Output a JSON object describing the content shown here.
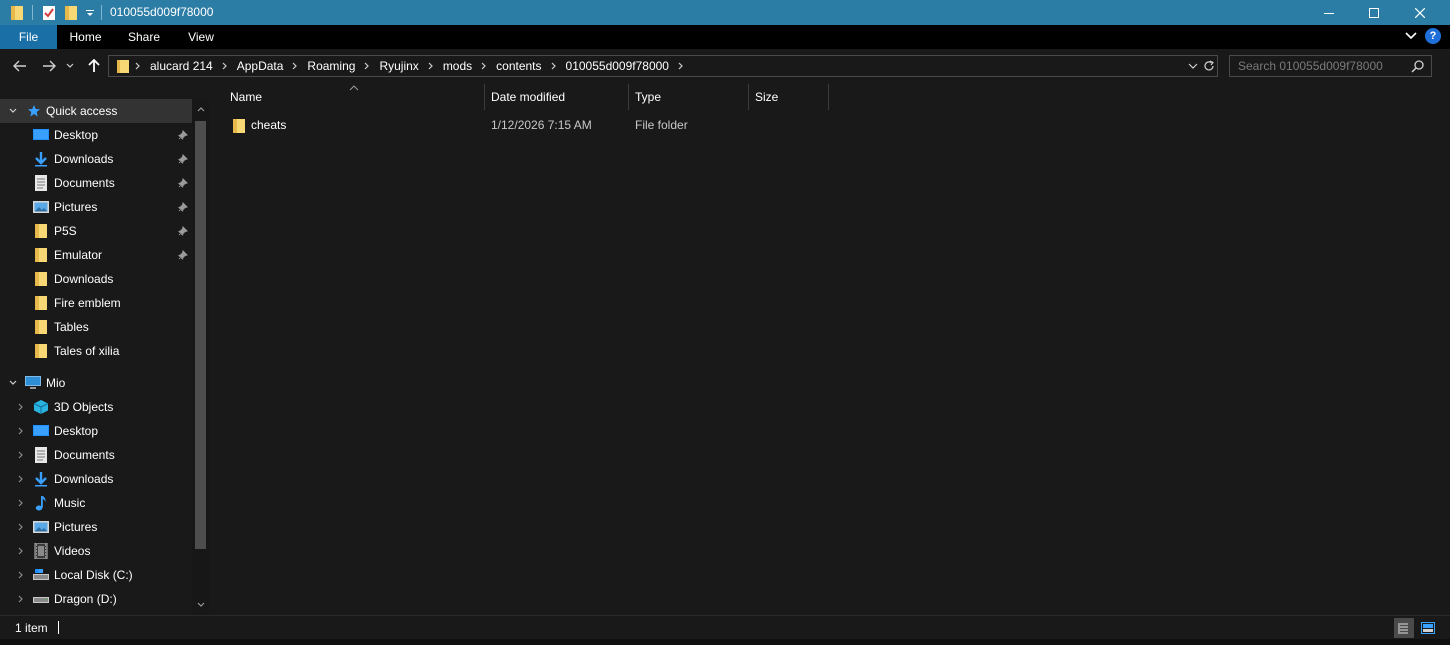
{
  "window": {
    "title": "010055d009f78000",
    "minimize_label": "Minimize",
    "maximize_label": "Maximize",
    "close_label": "Close"
  },
  "ribbon": {
    "tabs": [
      {
        "label": "File"
      },
      {
        "label": "Home"
      },
      {
        "label": "Share"
      },
      {
        "label": "View"
      }
    ],
    "help_label": "?"
  },
  "address_bar": {
    "crumbs": [
      "alucard 214",
      "AppData",
      "Roaming",
      "Ryujinx",
      "mods",
      "contents",
      "010055d009f78000"
    ]
  },
  "search": {
    "placeholder": "Search 010055d009f78000"
  },
  "sidebar": {
    "quick_access_label": "Quick access",
    "quick_access_items": [
      {
        "label": "Desktop",
        "icon": "desktop-icon",
        "pinned": true
      },
      {
        "label": "Downloads",
        "icon": "downloads-icon",
        "pinned": true
      },
      {
        "label": "Documents",
        "icon": "documents-icon",
        "pinned": true
      },
      {
        "label": "Pictures",
        "icon": "pictures-icon",
        "pinned": true
      },
      {
        "label": "P5S",
        "icon": "folder-icon",
        "pinned": true
      },
      {
        "label": "Emulator",
        "icon": "folder-icon",
        "pinned": true
      },
      {
        "label": "Downloads",
        "icon": "folder-icon",
        "pinned": false
      },
      {
        "label": "Fire emblem",
        "icon": "folder-icon",
        "pinned": false
      },
      {
        "label": "Tables",
        "icon": "folder-icon",
        "pinned": false
      },
      {
        "label": "Tales of xilia",
        "icon": "folder-icon",
        "pinned": false
      }
    ],
    "this_pc_label": "Mio",
    "this_pc_items": [
      {
        "label": "3D Objects",
        "icon": "3d-objects-icon"
      },
      {
        "label": "Desktop",
        "icon": "desktop-icon"
      },
      {
        "label": "Documents",
        "icon": "documents-icon"
      },
      {
        "label": "Downloads",
        "icon": "downloads-icon"
      },
      {
        "label": "Music",
        "icon": "music-icon"
      },
      {
        "label": "Pictures",
        "icon": "pictures-icon"
      },
      {
        "label": "Videos",
        "icon": "videos-icon"
      },
      {
        "label": "Local Disk (C:)",
        "icon": "local-disk-icon"
      },
      {
        "label": "Dragon (D:)",
        "icon": "drive-icon"
      }
    ]
  },
  "file_list": {
    "columns": [
      "Name",
      "Date modified",
      "Type",
      "Size"
    ],
    "rows": [
      {
        "name": "cheats",
        "date_modified": "1/12/2026 7:15 AM",
        "type": "File folder",
        "size": ""
      }
    ]
  },
  "status_bar": {
    "item_count": "1 item"
  },
  "colors": {
    "titlebar": "#2b7da6",
    "background": "#191919",
    "ribbon": "#000000",
    "file_tab": "#1a6fa6",
    "folder_yellow": "#f8d775",
    "accent_blue": "#3aa0ff"
  }
}
